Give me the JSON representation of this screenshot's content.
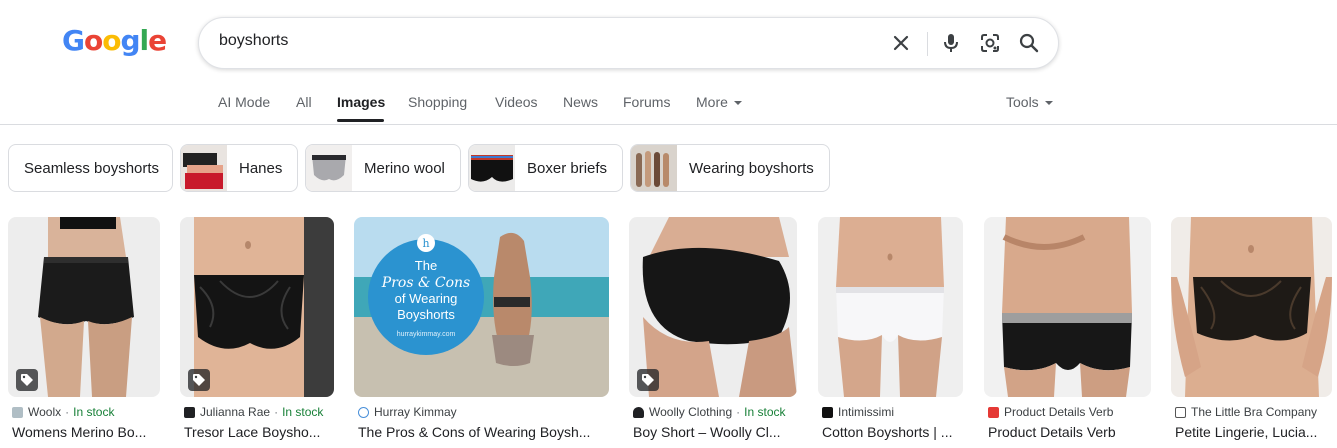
{
  "logo": {
    "letters": [
      "G",
      "o",
      "o",
      "g",
      "l",
      "e"
    ],
    "colors": [
      "#4285f4",
      "#ea4335",
      "#fbbc05",
      "#4285f4",
      "#34a853",
      "#ea4335"
    ]
  },
  "search": {
    "query": "boyshorts",
    "icons": [
      "close-icon",
      "mic-icon",
      "lens-icon",
      "search-icon"
    ]
  },
  "tabs": [
    {
      "label": "AI Mode"
    },
    {
      "label": "All"
    },
    {
      "label": "Images",
      "active": true
    },
    {
      "label": "Shopping"
    },
    {
      "label": "Videos"
    },
    {
      "label": "News"
    },
    {
      "label": "Forums"
    },
    {
      "label": "More"
    }
  ],
  "tools_label": "Tools",
  "chips": [
    {
      "label": "Seamless boyshorts"
    },
    {
      "label": "Hanes"
    },
    {
      "label": "Merino wool"
    },
    {
      "label": "Boxer briefs"
    },
    {
      "label": "Wearing boyshorts"
    }
  ],
  "results": [
    {
      "source": "Woolx",
      "stock": "In stock",
      "title": "Womens Merino Bo..."
    },
    {
      "source": "Julianna Rae",
      "stock": "In stock",
      "title": "Tresor Lace Boysho..."
    },
    {
      "source": "Hurray Kimmay",
      "stock": "",
      "title": "The Pros & Cons of Wearing Boysh...",
      "image_text": {
        "line1": "The",
        "line2": "Pros & Cons",
        "line3": "of Wearing",
        "line4": "Boyshorts",
        "site": "hurraykimmay.com",
        "badge": "h"
      }
    },
    {
      "source": "Woolly Clothing",
      "stock": "In stock",
      "title": "Boy Short – Woolly Cl..."
    },
    {
      "source": "Intimissimi",
      "stock": "",
      "title": "Cotton Boyshorts | ..."
    },
    {
      "source": "Product Details Verb",
      "stock": "",
      "title": "Product Details Verb"
    },
    {
      "source": "The Little Bra Company",
      "stock": "",
      "title": "Petite Lingerie, Lucia..."
    }
  ],
  "colors": {
    "accent_text": "#202124",
    "muted": "#5f6368",
    "stock_green": "#188038",
    "border": "#dadce0"
  }
}
